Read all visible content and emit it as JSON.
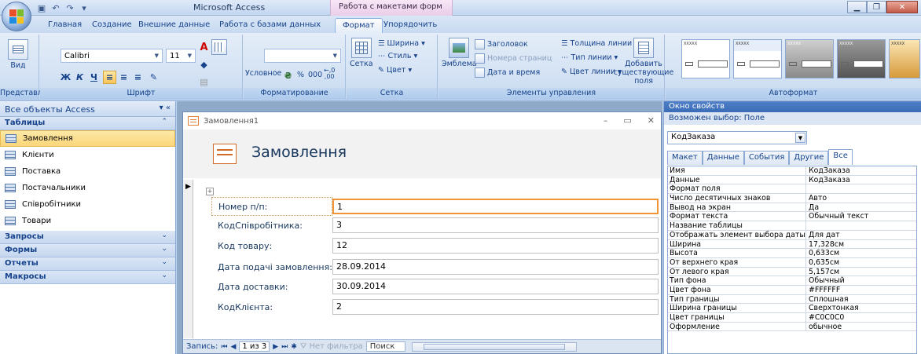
{
  "window": {
    "app_title": "Microsoft Access",
    "context_title": "Работа с макетами форм"
  },
  "ribbon_tabs": [
    {
      "label": "Главная"
    },
    {
      "label": "Создание"
    },
    {
      "label": "Внешние данные"
    },
    {
      "label": "Работа с базами данных"
    },
    {
      "label": "Формат"
    },
    {
      "label": "Упорядочить"
    }
  ],
  "ribbon": {
    "view": {
      "label": "Вид",
      "group": "Представл..."
    },
    "font": {
      "name": "Calibri",
      "size": "11",
      "bold": "Ж",
      "italic": "К",
      "underline": "Ч",
      "group": "Шрифт"
    },
    "formatting": {
      "conditional": "Условное",
      "percent": "%",
      "thousands": "000",
      "inc_decimals": "←,0",
      "dec_decimals": ",00",
      "group": "Форматирование"
    },
    "grid": {
      "label": "Сетка",
      "width": "Ширина",
      "style": "Стиль",
      "color": "Цвет",
      "group": "Сетка"
    },
    "controls": {
      "emblem": "Эмблема",
      "title": "Заголовок",
      "page_numbers": "Номера страниц",
      "date_time": "Дата и время",
      "line_width": "Толщина линии",
      "line_type": "Тип линии",
      "line_color": "Цвет линии",
      "add_fields": "Добавить существующие поля",
      "group": "Элементы управления"
    },
    "autoformat": {
      "group": "Автоформат"
    }
  },
  "nav": {
    "title": "Все объекты Access",
    "sections": {
      "tables": "Таблицы",
      "queries": "Запросы",
      "forms": "Формы",
      "reports": "Отчеты",
      "macros": "Макросы"
    },
    "tables": [
      {
        "label": "Замовлення"
      },
      {
        "label": "Клієнти"
      },
      {
        "label": "Поставка"
      },
      {
        "label": "Постачальники"
      },
      {
        "label": "Співробітники"
      },
      {
        "label": "Товари"
      }
    ]
  },
  "form": {
    "window_title": "Замовлення1",
    "header_title": "Замовлення",
    "fields": [
      {
        "label": "Номер п/п:",
        "value": "1"
      },
      {
        "label": "КодСпівробітника:",
        "value": "3"
      },
      {
        "label": "Код товару:",
        "value": "12"
      },
      {
        "label": "Дата подачі замовлення:",
        "value": "28.09.2014"
      },
      {
        "label": "Дата доставки:",
        "value": "30.09.2014"
      },
      {
        "label": "КодКлієнта:",
        "value": "2"
      }
    ],
    "record_bar": {
      "label": "Запись:",
      "current": "1 из 3",
      "filter": "Нет фильтра",
      "search": "Поиск"
    }
  },
  "props": {
    "title": "Окно свойств",
    "selection_type": "Возможен выбор: Поле",
    "selected": "КодЗаказа",
    "tabs": [
      {
        "label": "Макет"
      },
      {
        "label": "Данные"
      },
      {
        "label": "События"
      },
      {
        "label": "Другие"
      },
      {
        "label": "Все"
      }
    ],
    "rows": [
      {
        "key": "Имя",
        "value": "КодЗаказа"
      },
      {
        "key": "Данные",
        "value": "КодЗаказа"
      },
      {
        "key": "Формат поля",
        "value": ""
      },
      {
        "key": "Число десятичных знаков",
        "value": "Авто"
      },
      {
        "key": "Вывод на экран",
        "value": "Да"
      },
      {
        "key": "Формат текста",
        "value": "Обычный текст"
      },
      {
        "key": "Название таблицы",
        "value": ""
      },
      {
        "key": "Отображать элемент выбора даты",
        "value": "Для дат"
      },
      {
        "key": "Ширина",
        "value": "17,328см"
      },
      {
        "key": "Высота",
        "value": "0,633см"
      },
      {
        "key": "От верхнего края",
        "value": "0,635см"
      },
      {
        "key": "От левого края",
        "value": "5,157см"
      },
      {
        "key": "Тип фона",
        "value": "Обычный"
      },
      {
        "key": "Цвет фона",
        "value": "#FFFFFF"
      },
      {
        "key": "Тип границы",
        "value": "Сплошная"
      },
      {
        "key": "Ширина границы",
        "value": "Сверхтонкая"
      },
      {
        "key": "Цвет границы",
        "value": "#C0C0C0"
      },
      {
        "key": "Оформление",
        "value": "обычное"
      }
    ]
  }
}
